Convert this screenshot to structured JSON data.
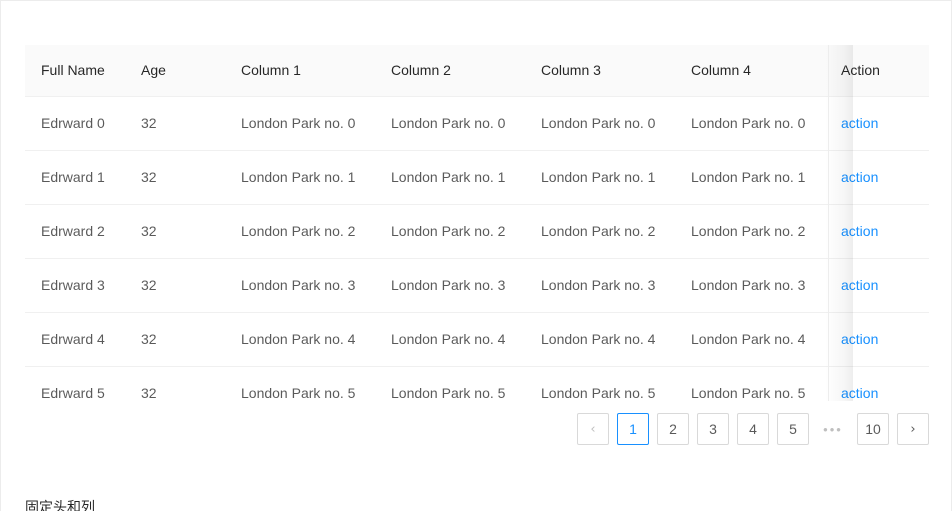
{
  "table": {
    "columns": [
      {
        "key": "name",
        "label": "Full Name"
      },
      {
        "key": "age",
        "label": "Age"
      },
      {
        "key": "c1",
        "label": "Column 1"
      },
      {
        "key": "c2",
        "label": "Column 2"
      },
      {
        "key": "c3",
        "label": "Column 3"
      },
      {
        "key": "c4",
        "label": "Column 4"
      },
      {
        "key": "action",
        "label": "Action"
      }
    ],
    "rows": [
      {
        "name": "Edrward 0",
        "age": "32",
        "c1": "London Park no. 0",
        "c2": "London Park no. 0",
        "c3": "London Park no. 0",
        "c4": "London Park no. 0",
        "action": "action"
      },
      {
        "name": "Edrward 1",
        "age": "32",
        "c1": "London Park no. 1",
        "c2": "London Park no. 1",
        "c3": "London Park no. 1",
        "c4": "London Park no. 1",
        "action": "action"
      },
      {
        "name": "Edrward 2",
        "age": "32",
        "c1": "London Park no. 2",
        "c2": "London Park no. 2",
        "c3": "London Park no. 2",
        "c4": "London Park no. 2",
        "action": "action"
      },
      {
        "name": "Edrward 3",
        "age": "32",
        "c1": "London Park no. 3",
        "c2": "London Park no. 3",
        "c3": "London Park no. 3",
        "c4": "London Park no. 3",
        "action": "action"
      },
      {
        "name": "Edrward 4",
        "age": "32",
        "c1": "London Park no. 4",
        "c2": "London Park no. 4",
        "c3": "London Park no. 4",
        "c4": "London Park no. 4",
        "action": "action"
      },
      {
        "name": "Edrward 5",
        "age": "32",
        "c1": "London Park no. 5",
        "c2": "London Park no. 5",
        "c3": "London Park no. 5",
        "c4": "London Park no. 5",
        "action": "action"
      }
    ]
  },
  "pagination": {
    "prev_label": "‹",
    "next_label": "›",
    "pages": [
      "1",
      "2",
      "3",
      "4",
      "5"
    ],
    "ellipsis": "•••",
    "last_page": "10",
    "current": "1"
  },
  "caption": "固定头和列",
  "colors": {
    "accent": "#1890ff",
    "header_bg": "#fafafa",
    "border": "#f0f0f0",
    "text": "#000000a6"
  }
}
